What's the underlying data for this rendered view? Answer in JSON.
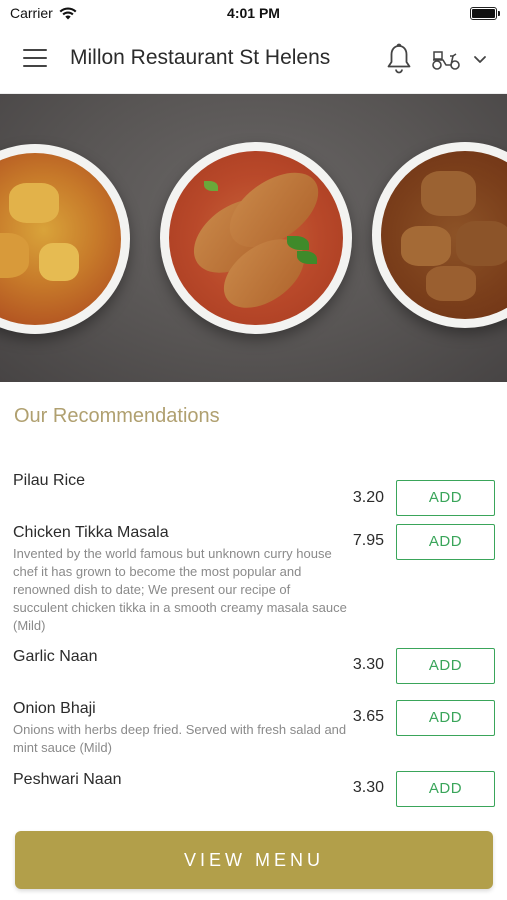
{
  "status_bar": {
    "carrier": "Carrier",
    "time": "4:01 PM",
    "icons": [
      "wifi-icon",
      "battery-icon"
    ]
  },
  "header": {
    "title": "Millon Restaurant St Helens",
    "icons": [
      "menu-icon",
      "bell-icon",
      "delivery-scooter-icon",
      "chevron-down-icon"
    ]
  },
  "hero": {
    "image": "three curry bowls on dark stone surface"
  },
  "section": {
    "title": "Our Recommendations"
  },
  "items": [
    {
      "name": "Pilau Rice",
      "description": "",
      "price": "3.20",
      "button": "ADD"
    },
    {
      "name": "Chicken Tikka Masala",
      "description": "Invented by the world famous but unknown curry house chef it has grown to become the most popular and renowned dish to date; We present our recipe of succulent chicken tikka in a smooth creamy masala sauce (Mild)",
      "price": "7.95",
      "button": "ADD"
    },
    {
      "name": "Garlic Naan",
      "description": "",
      "price": "3.30",
      "button": "ADD"
    },
    {
      "name": "Onion Bhaji",
      "description": "Onions with herbs deep fried. Served with fresh salad and mint sauce (Mild)",
      "price": "3.65",
      "button": "ADD"
    },
    {
      "name": "Peshwari Naan",
      "description": "",
      "price": "3.30",
      "button": "ADD"
    }
  ],
  "footer": {
    "view_menu_label": "VIEW MENU"
  },
  "colors": {
    "accent_gold": "#b29f4a",
    "section_title": "#b0a070",
    "add_green": "#3aa55a",
    "description_gray": "#8a8a8a"
  }
}
